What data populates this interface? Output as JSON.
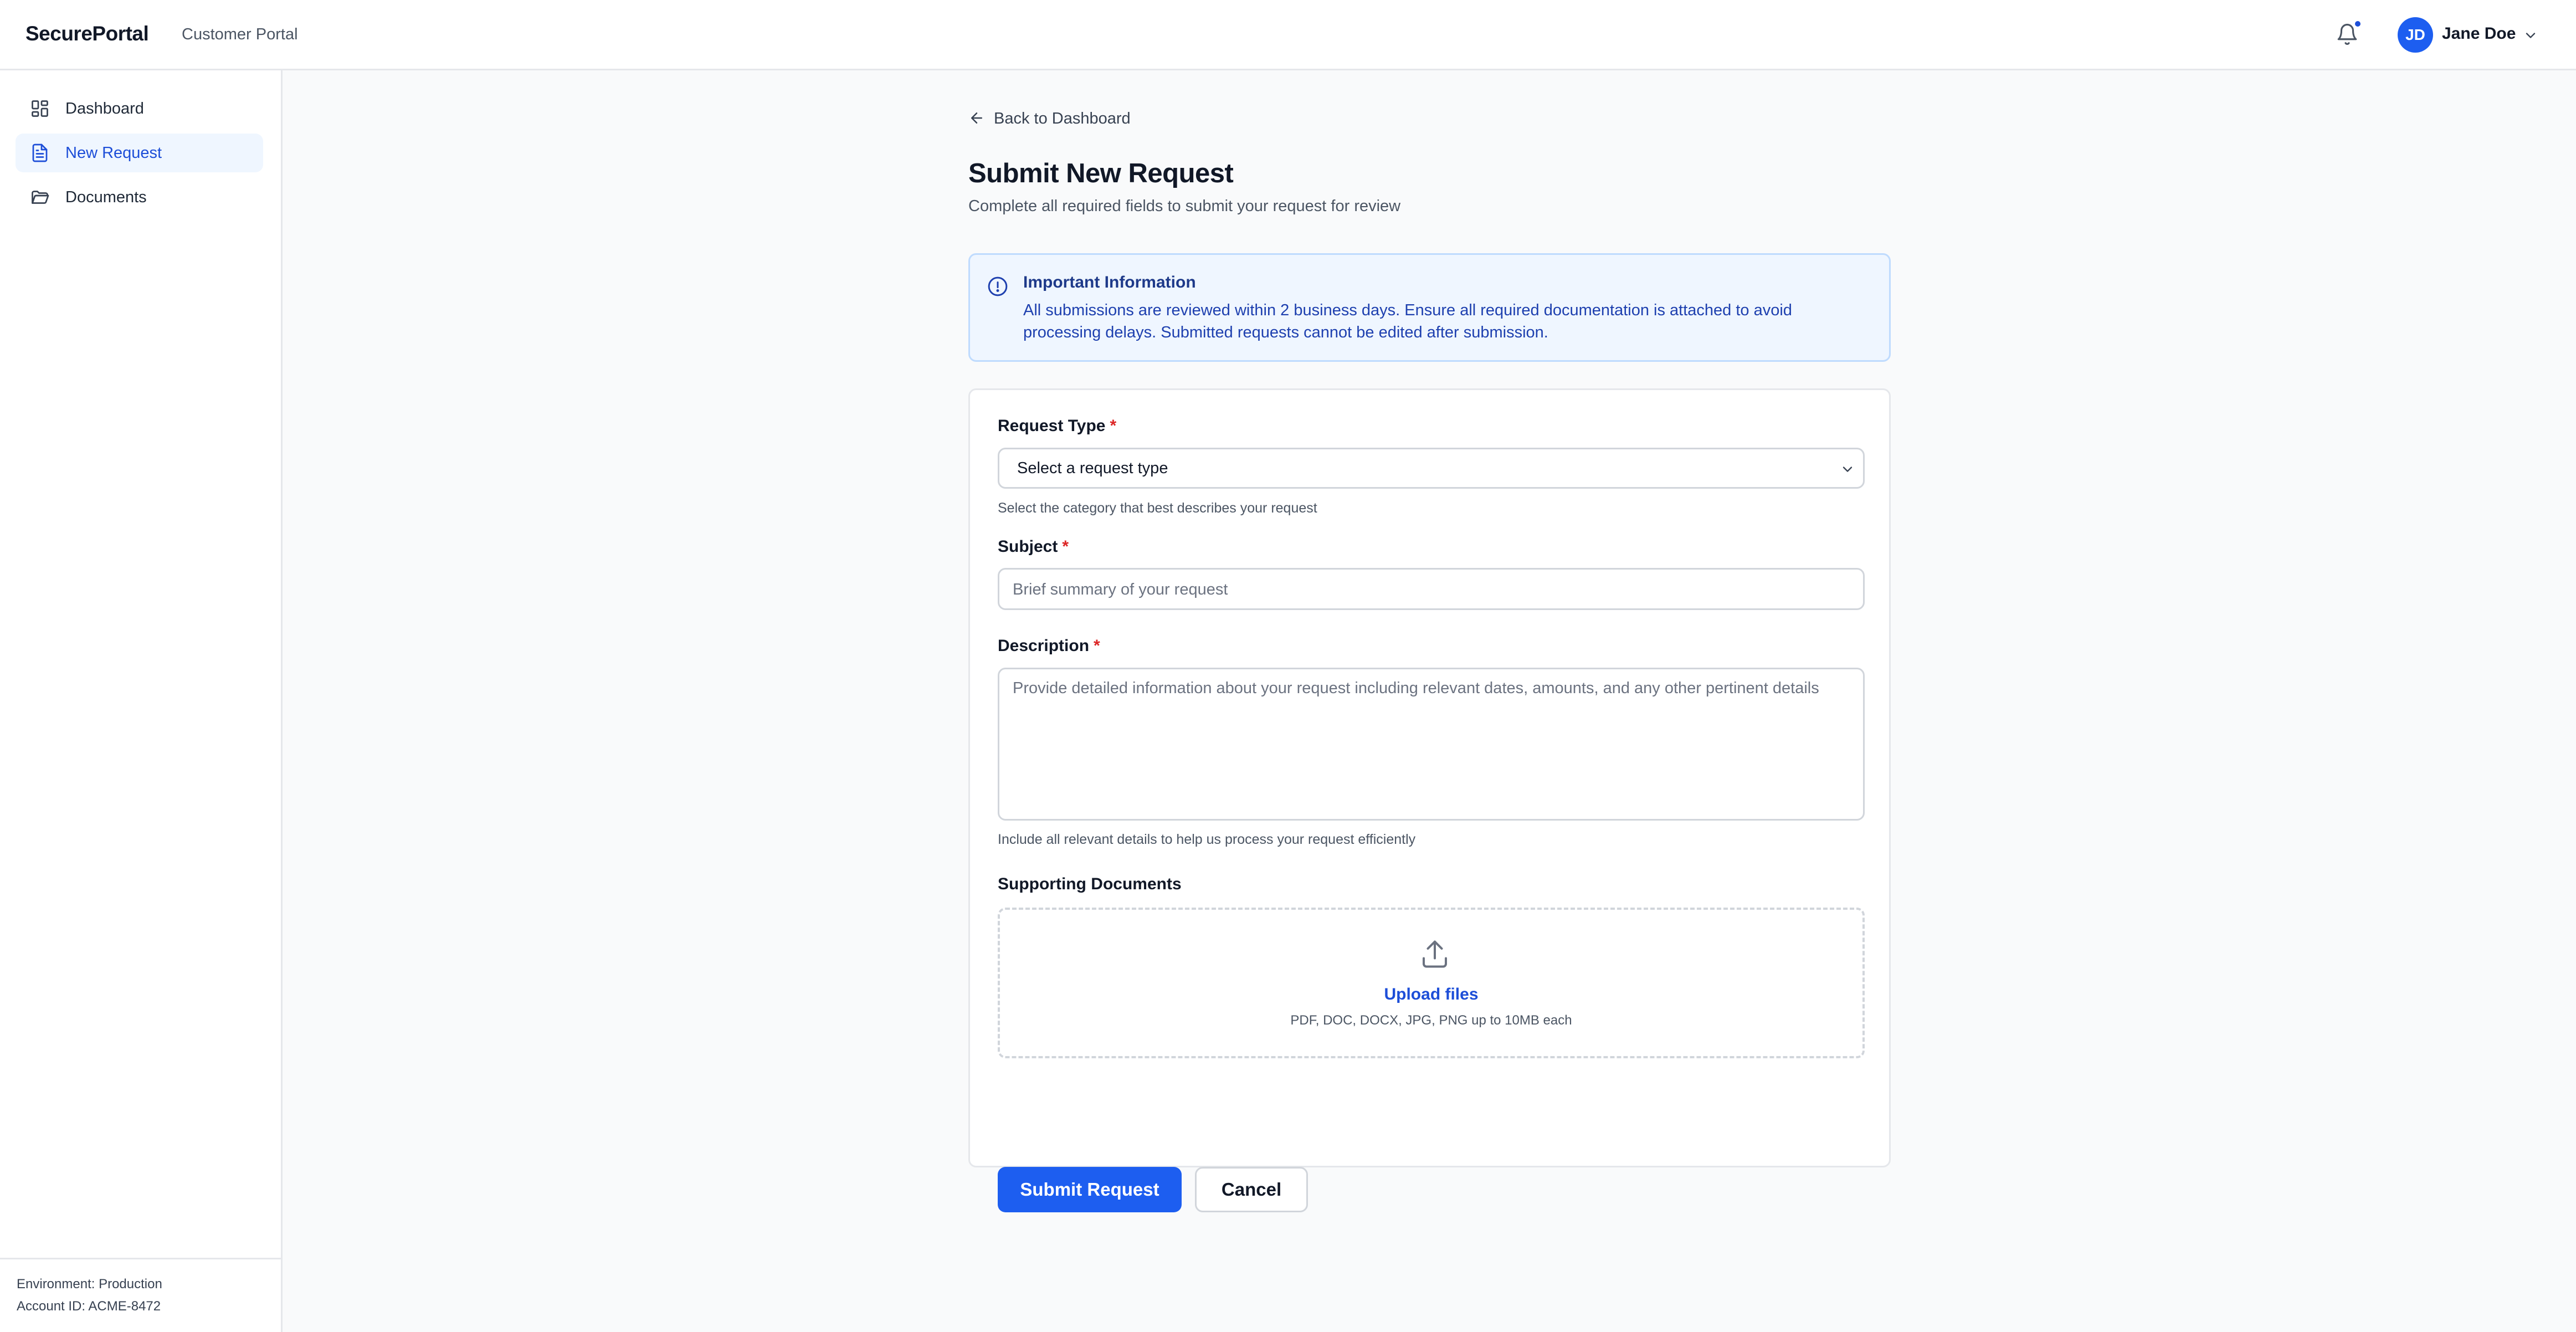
{
  "app": {
    "brand": "SecurePortal",
    "subtitle": "Customer Portal"
  },
  "header": {
    "notifications_icon": "bell-icon",
    "has_unread": true,
    "user": {
      "initials": "JD",
      "name": "Jane Doe"
    }
  },
  "sidebar": {
    "items": [
      {
        "label": "Dashboard",
        "icon": "grid-icon",
        "active": false
      },
      {
        "label": "New Request",
        "icon": "document-icon",
        "active": true
      },
      {
        "label": "Documents",
        "icon": "folder-icon",
        "active": false
      }
    ],
    "footer": {
      "environment": "Environment: Production",
      "account": "Account ID: ACME-8472"
    }
  },
  "main": {
    "back_label": "Back to Dashboard",
    "title": "Submit New Request",
    "subtitle": "Complete all required fields to submit your request for review",
    "info": {
      "title": "Important Information",
      "text": "All submissions are reviewed within 2 business days. Ensure all required documentation is attached to avoid processing delays. Submitted requests cannot be edited after submission."
    },
    "form": {
      "request_type": {
        "label": "Request Type",
        "required_mark": "*",
        "selected": "Select a request type",
        "help": "Select the category that best describes your request"
      },
      "subject": {
        "label": "Subject",
        "required_mark": "*",
        "placeholder": "Brief summary of your request"
      },
      "description": {
        "label": "Description",
        "required_mark": "*",
        "placeholder": "Provide detailed information about your request including relevant dates, amounts, and any other pertinent details",
        "help": "Include all relevant details to help us process your request efficiently"
      },
      "documents": {
        "label": "Supporting Documents",
        "upload_label": "Upload files",
        "upload_hint": "PDF, DOC, DOCX, JPG, PNG up to 10MB each"
      },
      "submit_label": "Submit Request",
      "cancel_label": "Cancel"
    }
  },
  "colors": {
    "accent": "#1d5ef0",
    "info_bg": "#eff6ff",
    "required": "#dc2626"
  }
}
